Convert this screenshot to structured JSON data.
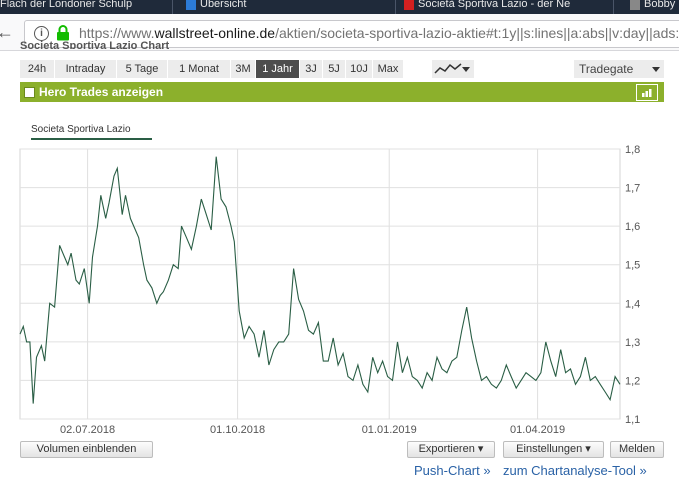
{
  "browser": {
    "tabs": [
      {
        "label": "Flach der Londoner Schulp"
      },
      {
        "label": "Übersicht"
      },
      {
        "label": "Società Sportiva Lazio - der Ne"
      },
      {
        "label": "Bobby"
      }
    ],
    "url_prefix": "https://www.",
    "url_domain": "wallstreet-online.de",
    "url_path": "/aktien/societa-sportiva-lazio-aktie#t:1y||s:lines||a:abs||v:day||ads:"
  },
  "widget": {
    "title": "Societa Sportiva Lazio Chart",
    "ranges": [
      "24h",
      "Intraday",
      "5 Tage",
      "1 Monat",
      "3M",
      "1 Jahr",
      "3J",
      "5J",
      "10J",
      "Max"
    ],
    "active_range": "1 Jahr",
    "exchange": "Tradegate",
    "hero_trades_label": "Hero Trades anzeigen",
    "hero_trades_checked": false,
    "volume_button": "Volumen einblenden",
    "export_button": "Exportieren ▾",
    "settings_button": "Einstellungen ▾",
    "report_button": "Melden",
    "push_chart_link": "Push-Chart »",
    "analysis_link": "zum Chartanalyse-Tool »",
    "colors": {
      "accent_green": "#8cb02c",
      "line": "#2a5e45",
      "link": "#2a62a6"
    }
  },
  "chart_data": {
    "type": "line",
    "title": "",
    "xlabel": "",
    "ylabel": "",
    "x_ticks": [
      "02.07.2018",
      "01.10.2018",
      "01.01.2019",
      "01.04.2019"
    ],
    "y_ticks": [
      "1,8",
      "1,7",
      "1,6",
      "1,5",
      "1,4",
      "1,3",
      "1,2",
      "1,1"
    ],
    "ylim": [
      1.1,
      1.8
    ],
    "xlim": [
      "2018-05-22",
      "2019-05-21"
    ],
    "grid": true,
    "legend_position": "top-left",
    "series": [
      {
        "name": "Societa Sportiva Lazio",
        "x": [
          "2018-05-22",
          "2018-05-24",
          "2018-05-26",
          "2018-05-28",
          "2018-05-30",
          "2018-06-01",
          "2018-06-04",
          "2018-06-06",
          "2018-06-09",
          "2018-06-12",
          "2018-06-15",
          "2018-06-18",
          "2018-06-20",
          "2018-06-22",
          "2018-06-25",
          "2018-06-27",
          "2018-06-30",
          "2018-07-03",
          "2018-07-05",
          "2018-07-08",
          "2018-07-10",
          "2018-07-13",
          "2018-07-15",
          "2018-07-18",
          "2018-07-20",
          "2018-07-23",
          "2018-07-25",
          "2018-07-28",
          "2018-07-31",
          "2018-08-02",
          "2018-08-05",
          "2018-08-07",
          "2018-08-10",
          "2018-08-13",
          "2018-08-15",
          "2018-08-17",
          "2018-08-20",
          "2018-08-23",
          "2018-08-26",
          "2018-08-28",
          "2018-08-31",
          "2018-09-03",
          "2018-09-06",
          "2018-09-09",
          "2018-09-12",
          "2018-09-15",
          "2018-09-18",
          "2018-09-21",
          "2018-09-24",
          "2018-09-27",
          "2018-09-29",
          "2018-10-02",
          "2018-10-05",
          "2018-10-08",
          "2018-10-11",
          "2018-10-14",
          "2018-10-17",
          "2018-10-20",
          "2018-10-23",
          "2018-10-26",
          "2018-10-29",
          "2018-11-01",
          "2018-11-04",
          "2018-11-07",
          "2018-11-10",
          "2018-11-13",
          "2018-11-16",
          "2018-11-19",
          "2018-11-22",
          "2018-11-25",
          "2018-11-28",
          "2018-12-01",
          "2018-12-04",
          "2018-12-07",
          "2018-12-10",
          "2018-12-13",
          "2018-12-16",
          "2018-12-19",
          "2018-12-22",
          "2018-12-25",
          "2018-12-28",
          "2018-12-31",
          "2019-01-03",
          "2019-01-06",
          "2019-01-09",
          "2019-01-12",
          "2019-01-15",
          "2019-01-18",
          "2019-01-21",
          "2019-01-24",
          "2019-01-27",
          "2019-01-30",
          "2019-02-02",
          "2019-02-05",
          "2019-02-08",
          "2019-02-11",
          "2019-02-14",
          "2019-02-17",
          "2019-02-20",
          "2019-02-23",
          "2019-02-26",
          "2019-03-01",
          "2019-03-04",
          "2019-03-07",
          "2019-03-10",
          "2019-03-13",
          "2019-03-16",
          "2019-03-19",
          "2019-03-22",
          "2019-03-25",
          "2019-03-28",
          "2019-03-31",
          "2019-04-03",
          "2019-04-06",
          "2019-04-09",
          "2019-04-12",
          "2019-04-15",
          "2019-04-18",
          "2019-04-21",
          "2019-04-24",
          "2019-04-27",
          "2019-04-30",
          "2019-05-03",
          "2019-05-06",
          "2019-05-09",
          "2019-05-12",
          "2019-05-15",
          "2019-05-18",
          "2019-05-21"
        ],
        "y": [
          1.32,
          1.34,
          1.3,
          1.3,
          1.14,
          1.26,
          1.29,
          1.25,
          1.4,
          1.39,
          1.55,
          1.52,
          1.5,
          1.53,
          1.46,
          1.45,
          1.49,
          1.4,
          1.52,
          1.6,
          1.68,
          1.62,
          1.66,
          1.73,
          1.75,
          1.63,
          1.68,
          1.62,
          1.59,
          1.57,
          1.5,
          1.46,
          1.44,
          1.4,
          1.42,
          1.43,
          1.46,
          1.5,
          1.49,
          1.6,
          1.57,
          1.54,
          1.6,
          1.67,
          1.63,
          1.59,
          1.78,
          1.67,
          1.65,
          1.6,
          1.56,
          1.38,
          1.31,
          1.34,
          1.32,
          1.26,
          1.33,
          1.24,
          1.28,
          1.3,
          1.3,
          1.32,
          1.49,
          1.41,
          1.38,
          1.33,
          1.32,
          1.35,
          1.25,
          1.25,
          1.31,
          1.24,
          1.27,
          1.21,
          1.2,
          1.24,
          1.19,
          1.17,
          1.26,
          1.22,
          1.25,
          1.21,
          1.2,
          1.3,
          1.22,
          1.26,
          1.21,
          1.2,
          1.18,
          1.22,
          1.2,
          1.26,
          1.23,
          1.22,
          1.25,
          1.26,
          1.33,
          1.39,
          1.31,
          1.25,
          1.2,
          1.21,
          1.19,
          1.18,
          1.2,
          1.24,
          1.21,
          1.18,
          1.2,
          1.22,
          1.21,
          1.2,
          1.22,
          1.3,
          1.25,
          1.21,
          1.28,
          1.22,
          1.23,
          1.19,
          1.21,
          1.26,
          1.2,
          1.21,
          1.19,
          1.17,
          1.15,
          1.21,
          1.19
        ]
      }
    ]
  }
}
